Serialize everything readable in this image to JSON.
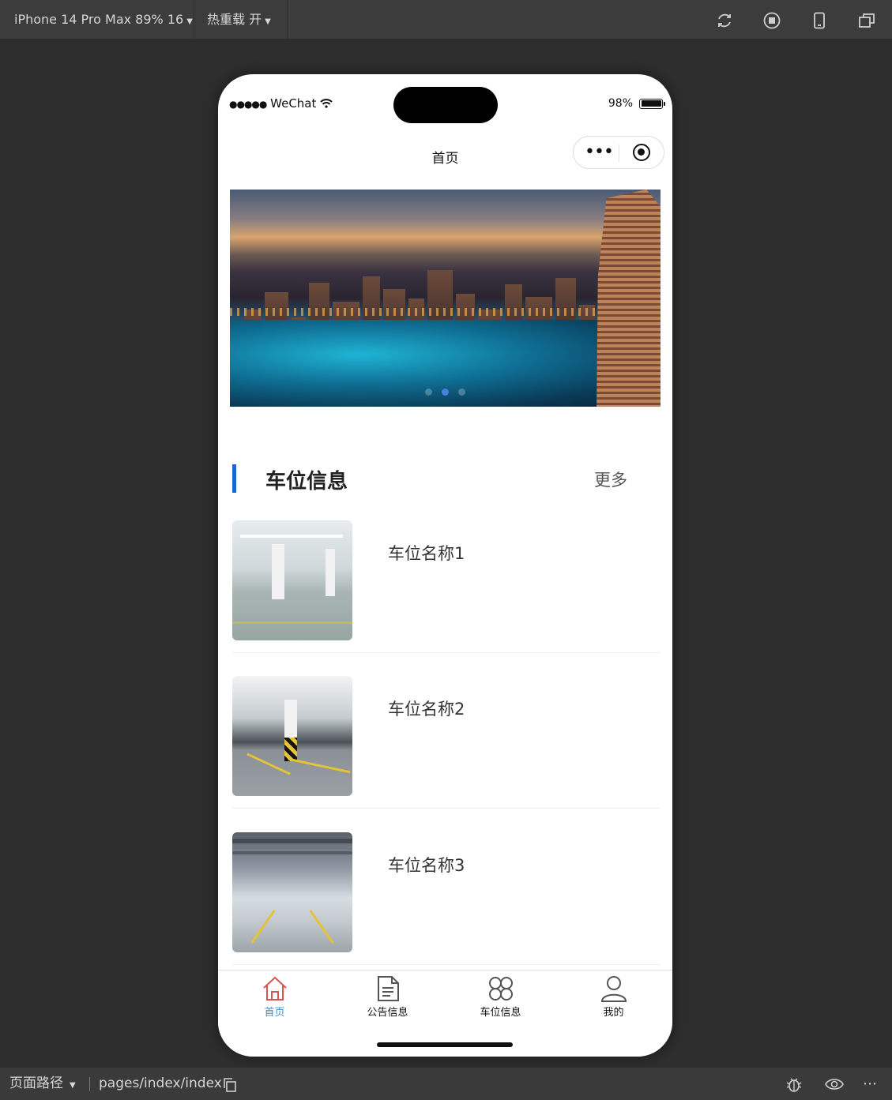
{
  "toolbar": {
    "device": "iPhone 14 Pro Max 89% 16",
    "hot_reload": "热重载 开",
    "icons": [
      "refresh-icon",
      "stop-icon",
      "phone-icon",
      "window-icon"
    ]
  },
  "status": {
    "signal": "●●●●●",
    "carrier": "WeChat",
    "battery": "98%"
  },
  "nav": {
    "title": "首页",
    "more_glyph": "•••"
  },
  "banner": {
    "slide_count": 3,
    "active_slide": 2
  },
  "section": {
    "title": "车位信息",
    "more": "更多"
  },
  "items": [
    {
      "name": "车位名称1"
    },
    {
      "name": "车位名称2"
    },
    {
      "name": "车位名称3"
    }
  ],
  "tabbar": [
    {
      "label": "首页",
      "icon": "home-icon",
      "active": true
    },
    {
      "label": "公告信息",
      "icon": "document-icon",
      "active": false
    },
    {
      "label": "车位信息",
      "icon": "grid-icon",
      "active": false
    },
    {
      "label": "我的",
      "icon": "user-icon",
      "active": false
    }
  ],
  "bottom": {
    "path_label": "页面路径",
    "path": "pages/index/index"
  },
  "colors": {
    "accent": "#1f63d6",
    "tab_active": "#3d8fc6",
    "home_icon": "#d9534f"
  }
}
